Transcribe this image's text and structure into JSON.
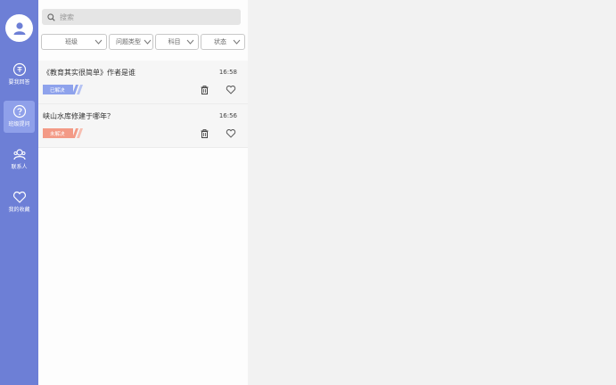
{
  "sidebar": {
    "items": [
      {
        "label": "要我回答",
        "icon": "answer-icon"
      },
      {
        "label": "班级提问",
        "icon": "question-icon"
      },
      {
        "label": "联系人",
        "icon": "contacts-icon"
      },
      {
        "label": "我的收藏",
        "icon": "heart-icon"
      }
    ]
  },
  "search": {
    "placeholder": "搜索"
  },
  "filters": [
    {
      "label": "班级"
    },
    {
      "label": "问题类型"
    },
    {
      "label": "科目"
    },
    {
      "label": "状态"
    }
  ],
  "questions": [
    {
      "title": "《教育其实很简单》作者是谁",
      "time": "16:58",
      "status": "已解决"
    },
    {
      "title": "峡山水库修建于哪年？",
      "time": "16:56",
      "status": "未解决"
    }
  ],
  "colors": {
    "sidebar": "#6d7fd6",
    "active": "#8fa0ea",
    "solved": "#8ea2ec",
    "unsolved": "#f39a86"
  }
}
